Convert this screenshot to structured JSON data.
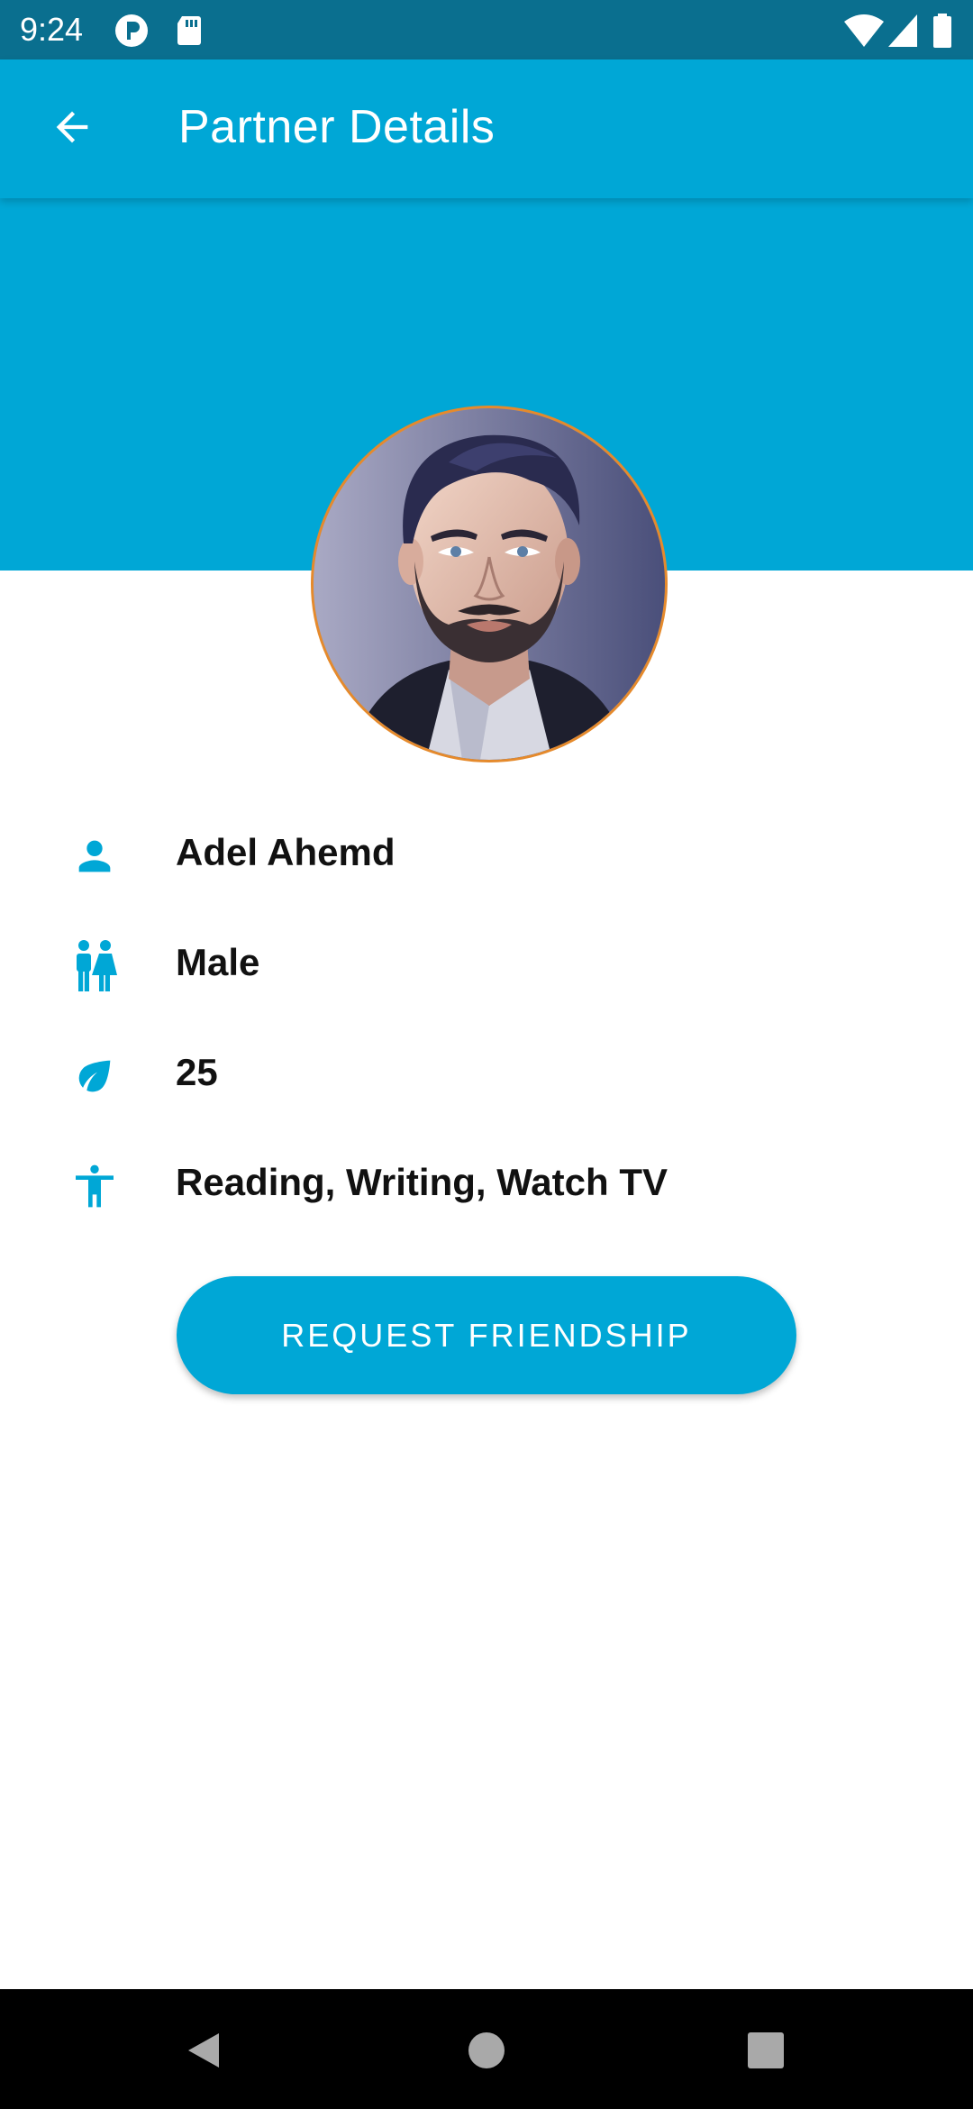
{
  "status_bar": {
    "time": "9:24",
    "icons": [
      "pin-app-icon",
      "sd-card-icon",
      "wifi-icon",
      "cell-signal-icon",
      "battery-icon"
    ]
  },
  "app_bar": {
    "title": "Partner Details",
    "back_icon": "arrow-back-icon"
  },
  "profile": {
    "avatar": "partner-avatar-illustration",
    "fields": [
      {
        "icon": "person-icon",
        "value": "Adel Ahemd"
      },
      {
        "icon": "gender-icon",
        "value": "Male"
      },
      {
        "icon": "leaf-icon",
        "value": "25"
      },
      {
        "icon": "accessibility-icon",
        "value": "Reading, Writing, Watch TV"
      }
    ]
  },
  "actions": {
    "request_label": "REQUEST FRIENDSHIP"
  },
  "nav_bar": {
    "icons": [
      "nav-back-icon",
      "nav-home-icon",
      "nav-recents-icon"
    ]
  },
  "colors": {
    "primary": "#00a7d6",
    "status_bar": "#0a6f8f",
    "avatar_border": "#e58a2c",
    "text": "#111111"
  }
}
